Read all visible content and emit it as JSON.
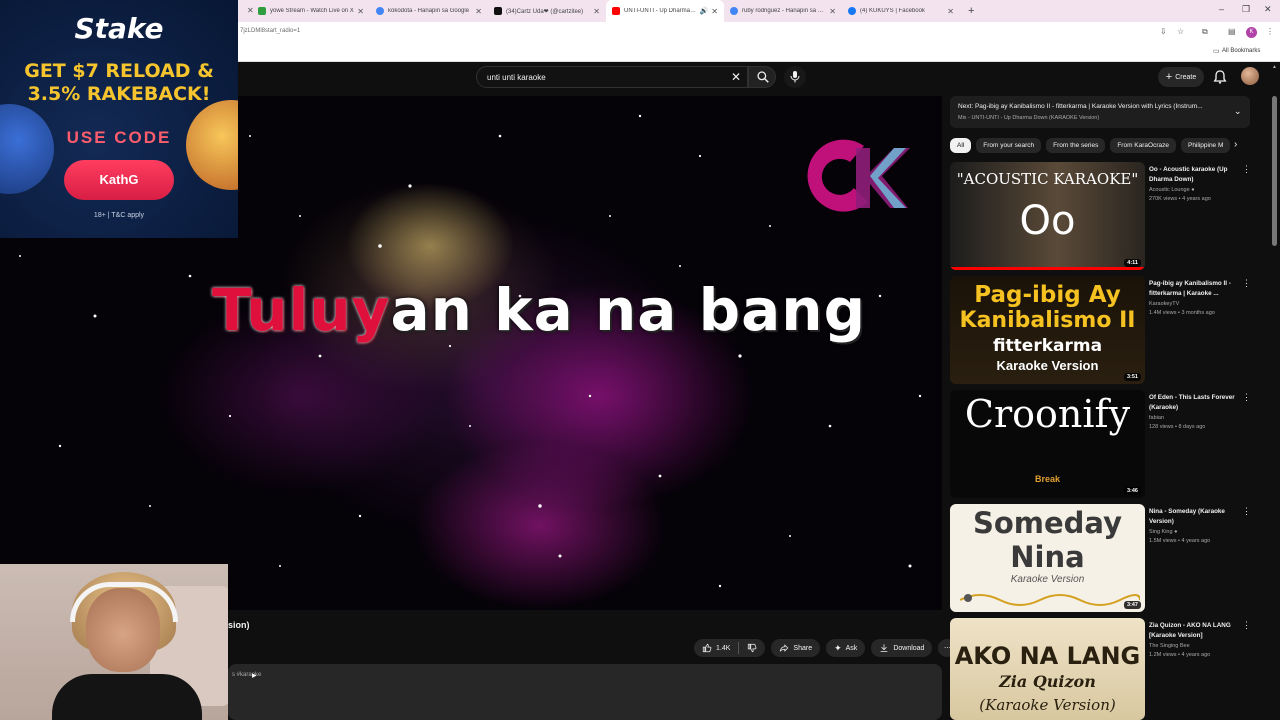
{
  "tabs": [
    {
      "title": "yowe Stream - Watch Live on X",
      "fav_color": "#2e9e3e",
      "active": false
    },
    {
      "title": "kokodota - Hanapin sa Google",
      "fav_color": "#4285f4",
      "active": false
    },
    {
      "title": "(34)Cartz Uda❤ (@cartzitee)",
      "fav_color": "#111111",
      "active": false
    },
    {
      "title": "UNTI-UNTI - Up Dharma Down",
      "fav_color": "#ff0000",
      "active": true
    },
    {
      "title": "ruby rodriguez - Hanapin sa Google",
      "fav_color": "#4285f4",
      "active": false
    },
    {
      "title": "(4) KUKUYS | Facebook",
      "fav_color": "#1877f2",
      "active": false
    }
  ],
  "address": {
    "url_fragment": "7jzLDMl8start_radio=1"
  },
  "bookmarks": {
    "all_label": "All Bookmarks"
  },
  "topbar": {
    "search_query": "unti unti karaoke",
    "create_label": "Create",
    "avatar_letter": "K"
  },
  "ad": {
    "brand": "Stake",
    "headline_1": "GET $7 RELOAD &",
    "headline_2": "3.5% RAKEBACK!",
    "use_code": "USE CODE",
    "code": "KathG",
    "fine_print": "18+ | T&C apply"
  },
  "video": {
    "lyric_sung": "Tuluy",
    "lyric_rest": "an ka na bang"
  },
  "below_video": {
    "title_fragment": "sion)",
    "like_count": "1.4K",
    "share_label": "Share",
    "ask_label": "Ask",
    "download_label": "Download",
    "description_fragment": "s #karaoke"
  },
  "up_next": {
    "title": "Next: Pag-ibig ay Kanibalismo II - fitterkarma | Karaoke Version with Lyrics (Instrum...",
    "subtitle": "Mix - UNTI-UNTI - Up Dharma Down (KARAOKE Version)"
  },
  "chips": [
    "All",
    "From your search",
    "From the series",
    "From KaraOcraze",
    "Philippine M"
  ],
  "recommendations": [
    {
      "title": "Oo - Acoustic karaoke (Up Dharma Down)",
      "channel": "Acoustic Lounge",
      "verified": true,
      "meta": "270K views • 4 years ago",
      "duration": "4:11",
      "thumb_line1": "\"ACOUSTIC KARAOKE\"",
      "thumb_line2": "Oo"
    },
    {
      "title": "Pag-ibig ay Kanibalismo II - fitterkarma | Karaoke ...",
      "channel": "KaraokeyTV",
      "verified": false,
      "meta": "1.4M views • 3 months ago",
      "duration": "3:51",
      "thumb_line1": "Pag-ibig Ay",
      "thumb_line2": "Kanibalismo II",
      "thumb_line3": "fitterkarma",
      "thumb_line4": "Karaoke Version"
    },
    {
      "title": "Of Eden - This Lasts Forever (Karaoke)",
      "channel": "fabian",
      "verified": false,
      "meta": "128 views • 8 days ago",
      "duration": "3:46",
      "thumb_line1": "Croonify",
      "thumb_line2": "Break"
    },
    {
      "title": "Nina - Someday (Karaoke Version)",
      "channel": "Sing King",
      "verified": true,
      "meta": "1.5M views • 4 years ago",
      "duration": "3:47",
      "thumb_line1": "Someday",
      "thumb_line2": "Nina",
      "thumb_line3": "Karaoke Version"
    },
    {
      "title": "Zia Quizon - AKO NA LANG [Karaoke Version]",
      "channel": "The Singing Bee",
      "verified": false,
      "meta": "1.2M views • 4 years ago",
      "duration": "",
      "thumb_line1": "AKO NA LANG",
      "thumb_line2": "Zia Quizon",
      "thumb_line3": "(Karaoke Version)"
    }
  ],
  "colors": {
    "accent": "#ff0000",
    "lyric_sung": "#e0103c",
    "background": "#0f0f0f"
  }
}
